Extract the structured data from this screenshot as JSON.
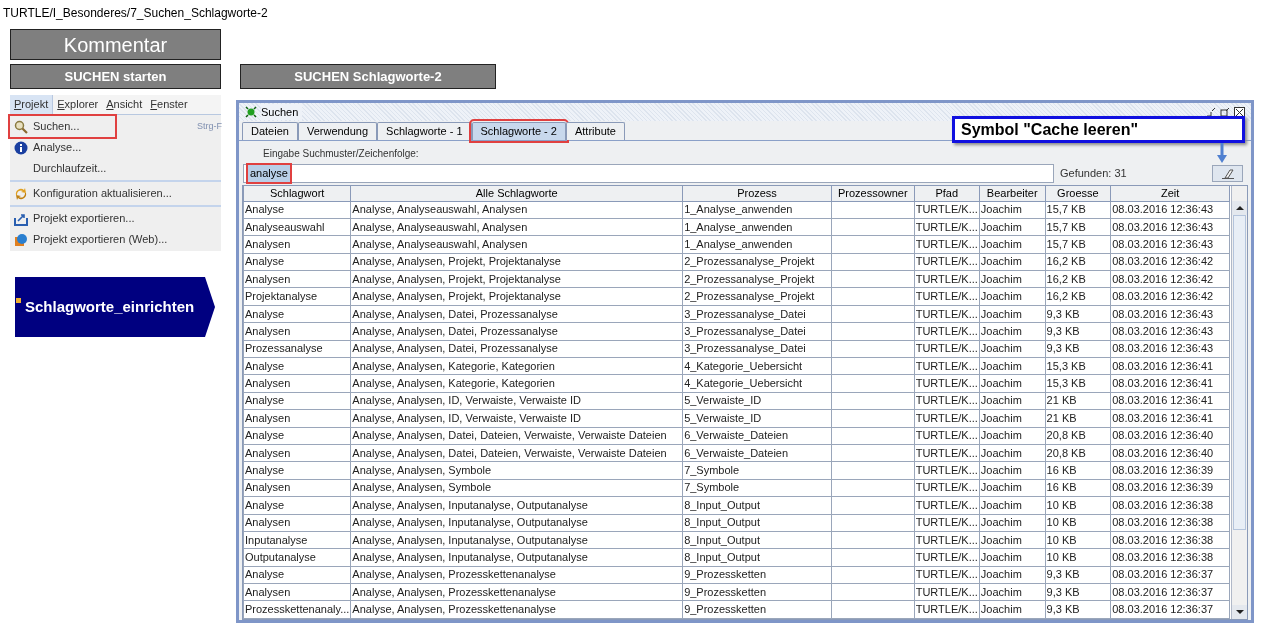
{
  "breadcrumb": "TURTLE/I_Besonderes/7_Suchen_Schlagworte-2",
  "comment_box": "Kommentar",
  "start_label": "SUCHEN starten",
  "section_label": "SUCHEN Schlagworte-2",
  "menubar": [
    {
      "label": "Projekt",
      "selected": true
    },
    {
      "label": "Explorer",
      "selected": false
    },
    {
      "label": "Ansicht",
      "selected": false
    },
    {
      "label": "Fenster",
      "selected": false
    }
  ],
  "menu_groups": [
    [
      {
        "label": "Suchen...",
        "shortcut": "Strg-F",
        "highlighted": true
      },
      {
        "label": "Analyse...",
        "highlighted": false
      },
      {
        "label": "Durchlaufzeit...",
        "highlighted": false
      }
    ],
    [
      {
        "label": "Konfiguration aktualisieren...",
        "highlighted": false
      }
    ],
    [
      {
        "label": "Projekt exportieren...",
        "highlighted": false
      },
      {
        "label": "Projekt exportieren (Web)...",
        "highlighted": false
      }
    ]
  ],
  "process_step": "Schlagworte_einrichten",
  "window": {
    "title": "Suchen",
    "tabs": [
      {
        "label": "Dateien",
        "selected": false,
        "highlighted": false
      },
      {
        "label": "Verwendung",
        "selected": false,
        "highlighted": false
      },
      {
        "label": "Schlagworte - 1",
        "selected": false,
        "highlighted": false
      },
      {
        "label": "Schlagworte - 2",
        "selected": true,
        "highlighted": true
      },
      {
        "label": "Attribute",
        "selected": false,
        "highlighted": false
      }
    ],
    "search_label": "Eingabe Suchmuster/Zeichenfolge:",
    "search": {
      "value": "analyse",
      "highlighted": true
    },
    "found": "Gefunden: 31",
    "callout": "Symbol \"Cache leeren\"",
    "table": {
      "columns": [
        "Schlagwort",
        "Alle Schlagworte",
        "Prozess",
        "Prozessowner",
        "Pfad",
        "Bearbeiter",
        "Groesse",
        "Zeit"
      ],
      "rows": [
        {
          "schlagwort": "Analyse",
          "alle": "Analyse, Analyseauswahl, Analysen",
          "prozess": "1_Analyse_anwenden",
          "pfad": "TURTLE/K...",
          "bearbeiter": "Joachim",
          "groesse": "15,7 KB",
          "zeit": "08.03.2016 12:36:43"
        },
        {
          "schlagwort": "Analyseauswahl",
          "alle": "Analyse, Analyseauswahl, Analysen",
          "prozess": "1_Analyse_anwenden",
          "pfad": "TURTLE/K...",
          "bearbeiter": "Joachim",
          "groesse": "15,7 KB",
          "zeit": "08.03.2016 12:36:43"
        },
        {
          "schlagwort": "Analysen",
          "alle": "Analyse, Analyseauswahl, Analysen",
          "prozess": "1_Analyse_anwenden",
          "pfad": "TURTLE/K...",
          "bearbeiter": "Joachim",
          "groesse": "15,7 KB",
          "zeit": "08.03.2016 12:36:43"
        },
        {
          "schlagwort": "Analyse",
          "alle": "Analyse, Analysen, Projekt, Projektanalyse",
          "prozess": "2_Prozessanalyse_Projekt",
          "pfad": "TURTLE/K...",
          "bearbeiter": "Joachim",
          "groesse": "16,2 KB",
          "zeit": "08.03.2016 12:36:42"
        },
        {
          "schlagwort": "Analysen",
          "alle": "Analyse, Analysen, Projekt, Projektanalyse",
          "prozess": "2_Prozessanalyse_Projekt",
          "pfad": "TURTLE/K...",
          "bearbeiter": "Joachim",
          "groesse": "16,2 KB",
          "zeit": "08.03.2016 12:36:42"
        },
        {
          "schlagwort": "Projektanalyse",
          "alle": "Analyse, Analysen, Projekt, Projektanalyse",
          "prozess": "2_Prozessanalyse_Projekt",
          "pfad": "TURTLE/K...",
          "bearbeiter": "Joachim",
          "groesse": "16,2 KB",
          "zeit": "08.03.2016 12:36:42"
        },
        {
          "schlagwort": "Analyse",
          "alle": "Analyse, Analysen, Datei, Prozessanalyse",
          "prozess": "3_Prozessanalyse_Datei",
          "pfad": "TURTLE/K...",
          "bearbeiter": "Joachim",
          "groesse": "9,3 KB",
          "zeit": "08.03.2016 12:36:43"
        },
        {
          "schlagwort": "Analysen",
          "alle": "Analyse, Analysen, Datei, Prozessanalyse",
          "prozess": "3_Prozessanalyse_Datei",
          "pfad": "TURTLE/K...",
          "bearbeiter": "Joachim",
          "groesse": "9,3 KB",
          "zeit": "08.03.2016 12:36:43"
        },
        {
          "schlagwort": "Prozessanalyse",
          "alle": "Analyse, Analysen, Datei, Prozessanalyse",
          "prozess": "3_Prozessanalyse_Datei",
          "pfad": "TURTLE/K...",
          "bearbeiter": "Joachim",
          "groesse": "9,3 KB",
          "zeit": "08.03.2016 12:36:43"
        },
        {
          "schlagwort": "Analyse",
          "alle": "Analyse, Analysen, Kategorie, Kategorien",
          "prozess": "4_Kategorie_Uebersicht",
          "pfad": "TURTLE/K...",
          "bearbeiter": "Joachim",
          "groesse": "15,3 KB",
          "zeit": "08.03.2016 12:36:41"
        },
        {
          "schlagwort": "Analysen",
          "alle": "Analyse, Analysen, Kategorie, Kategorien",
          "prozess": "4_Kategorie_Uebersicht",
          "pfad": "TURTLE/K...",
          "bearbeiter": "Joachim",
          "groesse": "15,3 KB",
          "zeit": "08.03.2016 12:36:41"
        },
        {
          "schlagwort": "Analyse",
          "alle": "Analyse, Analysen, ID, Verwaiste, Verwaiste ID",
          "prozess": "5_Verwaiste_ID",
          "pfad": "TURTLE/K...",
          "bearbeiter": "Joachim",
          "groesse": "21 KB",
          "zeit": "08.03.2016 12:36:41"
        },
        {
          "schlagwort": "Analysen",
          "alle": "Analyse, Analysen, ID, Verwaiste, Verwaiste ID",
          "prozess": "5_Verwaiste_ID",
          "pfad": "TURTLE/K...",
          "bearbeiter": "Joachim",
          "groesse": "21 KB",
          "zeit": "08.03.2016 12:36:41"
        },
        {
          "schlagwort": "Analyse",
          "alle": "Analyse, Analysen, Datei, Dateien, Verwaiste, Verwaiste Dateien",
          "prozess": "6_Verwaiste_Dateien",
          "pfad": "TURTLE/K...",
          "bearbeiter": "Joachim",
          "groesse": "20,8 KB",
          "zeit": "08.03.2016 12:36:40"
        },
        {
          "schlagwort": "Analysen",
          "alle": "Analyse, Analysen, Datei, Dateien, Verwaiste, Verwaiste Dateien",
          "prozess": "6_Verwaiste_Dateien",
          "pfad": "TURTLE/K...",
          "bearbeiter": "Joachim",
          "groesse": "20,8 KB",
          "zeit": "08.03.2016 12:36:40"
        },
        {
          "schlagwort": "Analyse",
          "alle": "Analyse, Analysen, Symbole",
          "prozess": "7_Symbole",
          "pfad": "TURTLE/K...",
          "bearbeiter": "Joachim",
          "groesse": "16 KB",
          "zeit": "08.03.2016 12:36:39"
        },
        {
          "schlagwort": "Analysen",
          "alle": "Analyse, Analysen, Symbole",
          "prozess": "7_Symbole",
          "pfad": "TURTLE/K...",
          "bearbeiter": "Joachim",
          "groesse": "16 KB",
          "zeit": "08.03.2016 12:36:39"
        },
        {
          "schlagwort": "Analyse",
          "alle": "Analyse, Analysen, Inputanalyse, Outputanalyse",
          "prozess": "8_Input_Output",
          "pfad": "TURTLE/K...",
          "bearbeiter": "Joachim",
          "groesse": "10 KB",
          "zeit": "08.03.2016 12:36:38"
        },
        {
          "schlagwort": "Analysen",
          "alle": "Analyse, Analysen, Inputanalyse, Outputanalyse",
          "prozess": "8_Input_Output",
          "pfad": "TURTLE/K...",
          "bearbeiter": "Joachim",
          "groesse": "10 KB",
          "zeit": "08.03.2016 12:36:38"
        },
        {
          "schlagwort": "Inputanalyse",
          "alle": "Analyse, Analysen, Inputanalyse, Outputanalyse",
          "prozess": "8_Input_Output",
          "pfad": "TURTLE/K...",
          "bearbeiter": "Joachim",
          "groesse": "10 KB",
          "zeit": "08.03.2016 12:36:38"
        },
        {
          "schlagwort": "Outputanalyse",
          "alle": "Analyse, Analysen, Inputanalyse, Outputanalyse",
          "prozess": "8_Input_Output",
          "pfad": "TURTLE/K...",
          "bearbeiter": "Joachim",
          "groesse": "10 KB",
          "zeit": "08.03.2016 12:36:38"
        },
        {
          "schlagwort": "Analyse",
          "alle": "Analyse, Analysen, Prozesskettenanalyse",
          "prozess": "9_Prozessketten",
          "pfad": "TURTLE/K...",
          "bearbeiter": "Joachim",
          "groesse": "9,3 KB",
          "zeit": "08.03.2016 12:36:37"
        },
        {
          "schlagwort": "Analysen",
          "alle": "Analyse, Analysen, Prozesskettenanalyse",
          "prozess": "9_Prozessketten",
          "pfad": "TURTLE/K...",
          "bearbeiter": "Joachim",
          "groesse": "9,3 KB",
          "zeit": "08.03.2016 12:36:37"
        },
        {
          "schlagwort": "Prozesskettenanaly...",
          "alle": "Analyse, Analysen, Prozesskettenanalyse",
          "prozess": "9_Prozessketten",
          "pfad": "TURTLE/K...",
          "bearbeiter": "Joachim",
          "groesse": "9,3 KB",
          "zeit": "08.03.2016 12:36:37"
        }
      ]
    }
  }
}
